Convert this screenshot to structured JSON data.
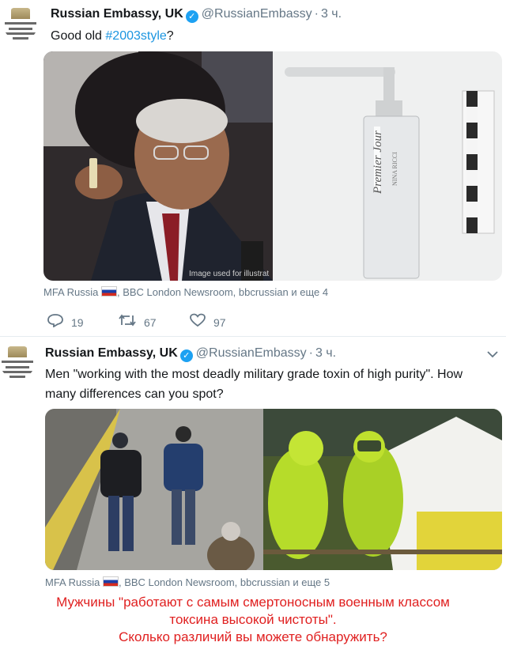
{
  "tweets": [
    {
      "name": "Russian Embassy, UK",
      "handle": "@RussianEmbassy",
      "time": "3 ч.",
      "text_before": "Good old ",
      "hashtag": "#2003style",
      "text_after": "?",
      "image_caption": "Image used for illustrat",
      "image_product_text": "Premier Jour",
      "image_brand_text": "NINA RICCI",
      "context_prefix": "MFA Russia",
      "context_rest": ", BBC London Newsroom, bbcrussian и еще 4",
      "replies": "19",
      "retweets": "67",
      "likes": "97"
    },
    {
      "name": "Russian Embassy, UK",
      "handle": "@RussianEmbassy",
      "time": "3 ч.",
      "text": "Men \"working with the most deadly military grade toxin of high purity\". How many differences can you spot?",
      "context_prefix": "MFA Russia",
      "context_rest": ", BBC London Newsroom, bbcrussian и еще 5"
    }
  ],
  "translation": {
    "line1": "Мужчины \"работают с самым смертоносным военным классом",
    "line2": "токсина высокой чистоты\".",
    "line3": "Сколько различий вы можете обнаружить?"
  },
  "icons": {
    "reply": "reply-icon",
    "retweet": "retweet-icon",
    "like": "heart-icon"
  },
  "colors": {
    "link": "#1b95e0",
    "muted": "#657786",
    "verified": "#1da1f2",
    "translation": "#e02020"
  }
}
